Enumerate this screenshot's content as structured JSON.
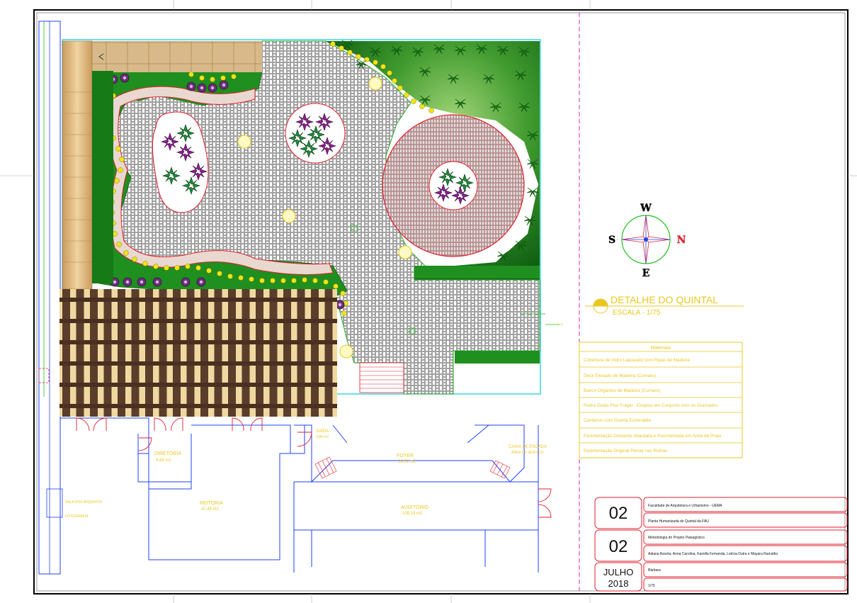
{
  "plan": {
    "title": "DETALHE DO QUINTAL",
    "scale": "ESCALA - 1/75"
  },
  "compass": {
    "north": "N",
    "south": "S",
    "east": "E",
    "west": "W"
  },
  "legend": {
    "heading": "Materiais",
    "items": [
      "Cobertura de Vidro Laqueado com Ripas de Madeira",
      "Deck Elevado de Madeira (Cumaru)",
      "Banco Orgânico de Madeira (Cumaru)",
      "Pedra Goiás Piso Fulget - Ecopiso em Conjunto com os Gramados",
      "Canteiros com Grama Esmeralda",
      "Pavimentação Drenante Abaulada e Pavimentada em Areia de Praia",
      "Pavimentação Original Pérola nas Ruinas"
    ]
  },
  "rooms": [
    {
      "name": "DIRETORIA",
      "area": "9,44 m2"
    },
    {
      "name": "REITORIA",
      "area": "47,45 m2"
    },
    {
      "name": "FOYER",
      "area": "28,61 m2"
    },
    {
      "name": "AUDITÓRIO",
      "area": "108,19 m2"
    },
    {
      "name": "SAÍDA",
      "area": "3,80 m2"
    },
    {
      "name": "CAIXA DE ESCADA",
      "area": "ÁREA DE SERVIÇO"
    },
    {
      "name": "SALA DOS ARQUIVOS",
      "area": "FOTOGRAFIA"
    }
  ],
  "title_block": {
    "sheet_number": "02",
    "sheet_total": "02",
    "date_month": "JULHO",
    "date_year": "2018",
    "institution": "Faculdade de Arquitetura e Urbanismo - UEMA",
    "project": "Planta Humanizada do Quintal da FAU",
    "course": "Metodologia do Projeto Paisagístico",
    "authors": "Adiana Assréa, Anna Carolina, Kamilla Fernanda, Letícia Dutra e Mayara Ramalho",
    "professor": "Bárbara",
    "scale": "1/75"
  },
  "colors": {
    "paving": "#bdbdbd",
    "grass": "#1f8f1f",
    "deck": "#d9b98a",
    "pergola": "#5a3d2b",
    "red_lines": "#e01f2c",
    "blue_lines": "#2040ff",
    "yellow_text": "#e8c820"
  }
}
